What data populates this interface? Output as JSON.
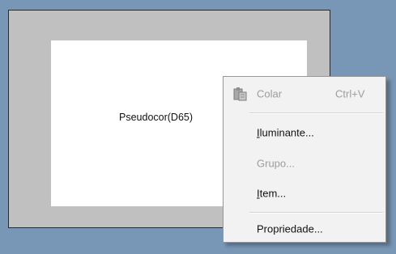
{
  "canvas": {
    "label": "Pseudocor(D65)"
  },
  "context_menu": {
    "items": [
      {
        "label": "Colar",
        "shortcut": "Ctrl+V",
        "icon": "paste-icon",
        "enabled": false
      },
      {
        "label_first": "I",
        "label_rest": "luminante...",
        "enabled": true
      },
      {
        "label": "Grupo...",
        "enabled": false
      },
      {
        "label_first": "I",
        "label_rest": "tem...",
        "enabled": true
      },
      {
        "label": "Propriedade...",
        "enabled": true
      }
    ]
  },
  "colors": {
    "desktop": "#7897b6",
    "frame": "#c0c0c0",
    "canvas": "#ffffff",
    "menu_bg": "#f2f2f2",
    "disabled_text": "#9d9d9d"
  }
}
